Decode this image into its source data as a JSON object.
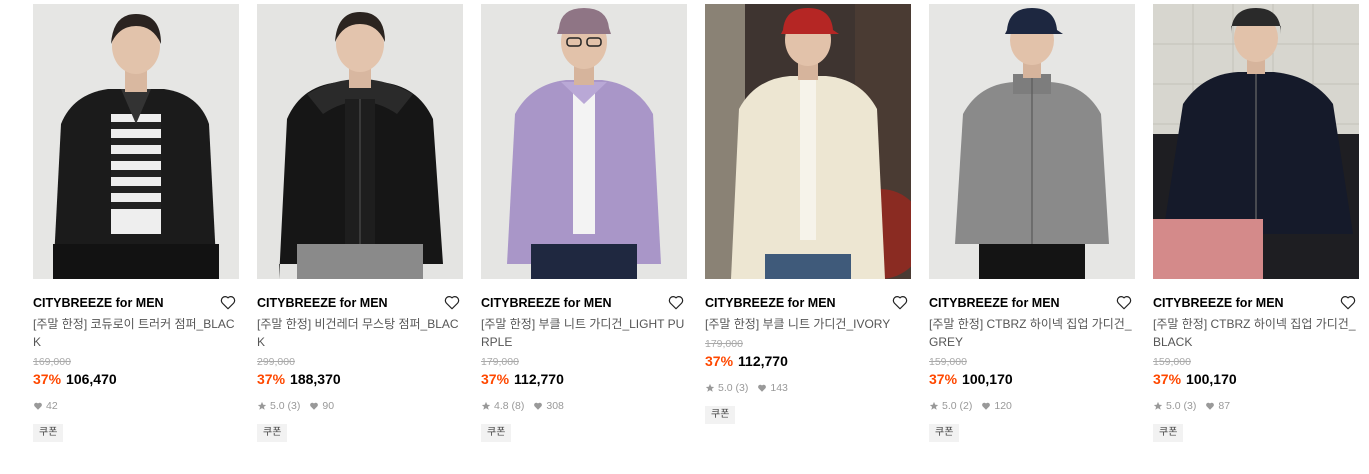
{
  "products": [
    {
      "brand": "CITYBREEZE for MEN",
      "name": "[주말 한정] 코듀로이 트러커 점퍼_BLACK",
      "original_price": "169,000",
      "discount": "37%",
      "price": "106,470",
      "rating": "",
      "reviews": "",
      "likes": "42",
      "coupon": "쿠폰"
    },
    {
      "brand": "CITYBREEZE for MEN",
      "name": "[주말 한정] 비건레더 무스탕 점퍼_BLACK",
      "original_price": "299,000",
      "discount": "37%",
      "price": "188,370",
      "rating": "5.0",
      "reviews": "(3)",
      "likes": "90",
      "coupon": "쿠폰"
    },
    {
      "brand": "CITYBREEZE for MEN",
      "name": "[주말 한정] 부클 니트 가디건_LIGHT PURPLE",
      "original_price": "179,000",
      "discount": "37%",
      "price": "112,770",
      "rating": "4.8",
      "reviews": "(8)",
      "likes": "308",
      "coupon": "쿠폰"
    },
    {
      "brand": "CITYBREEZE for MEN",
      "name": "[주말 한정] 부클 니트 가디건_IVORY",
      "original_price": "179,000",
      "discount": "37%",
      "price": "112,770",
      "rating": "5.0",
      "reviews": "(3)",
      "likes": "143",
      "coupon": "쿠폰"
    },
    {
      "brand": "CITYBREEZE for MEN",
      "name": "[주말 한정] CTBRZ 하이넥 집업 가디건_GREY",
      "original_price": "159,000",
      "discount": "37%",
      "price": "100,170",
      "rating": "5.0",
      "reviews": "(2)",
      "likes": "120",
      "coupon": "쿠폰"
    },
    {
      "brand": "CITYBREEZE for MEN",
      "name": "[주말 한정] CTBRZ 하이넥 집업 가디건_BLACK",
      "original_price": "159,000",
      "discount": "37%",
      "price": "100,170",
      "rating": "5.0",
      "reviews": "(3)",
      "likes": "87",
      "coupon": "쿠폰"
    }
  ],
  "colors": {
    "discount": "#ff4800",
    "muted": "#999999",
    "strike": "#aaaaaa"
  }
}
